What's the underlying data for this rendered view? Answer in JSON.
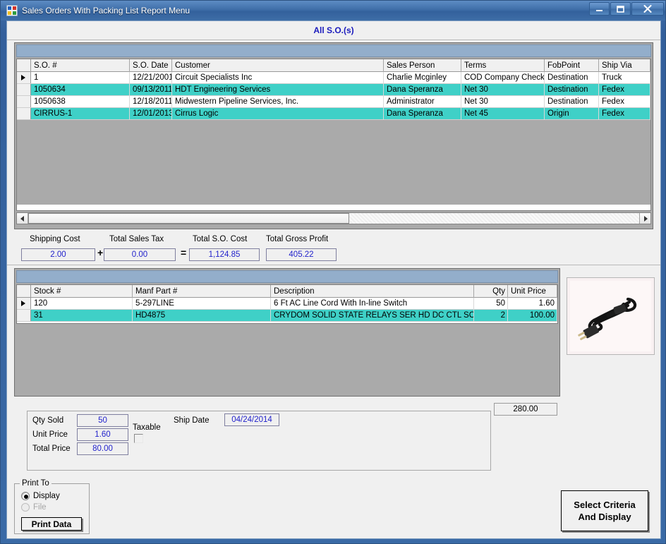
{
  "window": {
    "title": "Sales Orders With Packing List Report Menu",
    "minimize_label": "Minimize",
    "maximize_label": "Maximize",
    "close_label": "Close",
    "accent_title_color": "#3f6ea8",
    "highlight_color": "#3fd0c7",
    "band_color": "#93aecb",
    "value_text_color": "#2222cc"
  },
  "header": {
    "title": "All S.O.(s)"
  },
  "orders_grid": {
    "columns": [
      "S.O. #",
      "S.O. Date",
      "Customer",
      "Sales Person",
      "Terms",
      "FobPoint",
      "Ship Via"
    ],
    "rows": [
      {
        "so_number": "1",
        "so_date": "12/21/2001",
        "customer": "Circuit Specialists Inc",
        "sales_person": "Charlie Mcginley",
        "terms": "COD Company Check",
        "fob_point": "Destination",
        "ship_via": "Truck",
        "selected": false,
        "current": true
      },
      {
        "so_number": "1050634",
        "so_date": "09/13/2011",
        "customer": "HDT Engineering Services",
        "sales_person": "Dana Speranza",
        "terms": "Net 30",
        "fob_point": "Destination",
        "ship_via": "Fedex",
        "selected": true,
        "current": false
      },
      {
        "so_number": "1050638",
        "so_date": "12/18/2011",
        "customer": "Midwestern Pipeline Services, Inc.",
        "sales_person": "Administrator",
        "terms": "Net 30",
        "fob_point": "Destination",
        "ship_via": "Fedex",
        "selected": false,
        "current": false
      },
      {
        "so_number": "CIRRUS-1",
        "so_date": "12/01/2013",
        "customer": "Cirrus Logic",
        "sales_person": "Dana Speranza",
        "terms": "Net 45",
        "fob_point": "Origin",
        "ship_via": "Fedex",
        "selected": true,
        "current": false
      }
    ]
  },
  "totals": {
    "shipping_cost_label": "Shipping Cost",
    "shipping_cost_value": "2.00",
    "plus_sign": "+",
    "total_sales_tax_label": "Total Sales Tax",
    "total_sales_tax_value": "0.00",
    "equals_sign": "=",
    "total_so_cost_label": "Total S.O. Cost",
    "total_so_cost_value": "1,124.85",
    "total_gross_profit_label": "Total Gross Profit",
    "total_gross_profit_value": "405.22"
  },
  "items_grid": {
    "columns": [
      "Stock #",
      "Manf Part #",
      "Description",
      "Qty",
      "Unit Price"
    ],
    "rows": [
      {
        "stock_number": "120",
        "manf_part_number": "5-297LINE",
        "description": "6 Ft AC Line Cord With In-line Switch",
        "qty": "50",
        "unit_price": "1.60",
        "selected": false,
        "current": true
      },
      {
        "stock_number": "31",
        "manf_part_number": "HD4875",
        "description": "CRYDOM SOLID STATE RELAYS SER HD DC CTL SC",
        "qty": "2",
        "unit_price": "100.00",
        "selected": true,
        "current": false
      }
    ]
  },
  "product_image": {
    "alt": "AC line cord with in-line switch"
  },
  "line_detail": {
    "qty_sold_label": "Qty Sold",
    "qty_sold_value": "50",
    "unit_price_label": "Unit Price",
    "unit_price_value": "1.60",
    "total_price_label": "Total Price",
    "total_price_value": "80.00",
    "taxable_label": "Taxable",
    "taxable_checked": false,
    "ship_date_label": "Ship Date",
    "ship_date_value": "04/24/2014",
    "order_total_value": "280.00"
  },
  "print_to": {
    "group_label": "Print To",
    "options": [
      {
        "label": "Display",
        "selected": true,
        "disabled": false
      },
      {
        "label": "File",
        "selected": false,
        "disabled": true
      }
    ],
    "print_button_label": "Print Data"
  },
  "actions": {
    "select_criteria_line1": "Select Criteria",
    "select_criteria_line2": "And Display"
  }
}
